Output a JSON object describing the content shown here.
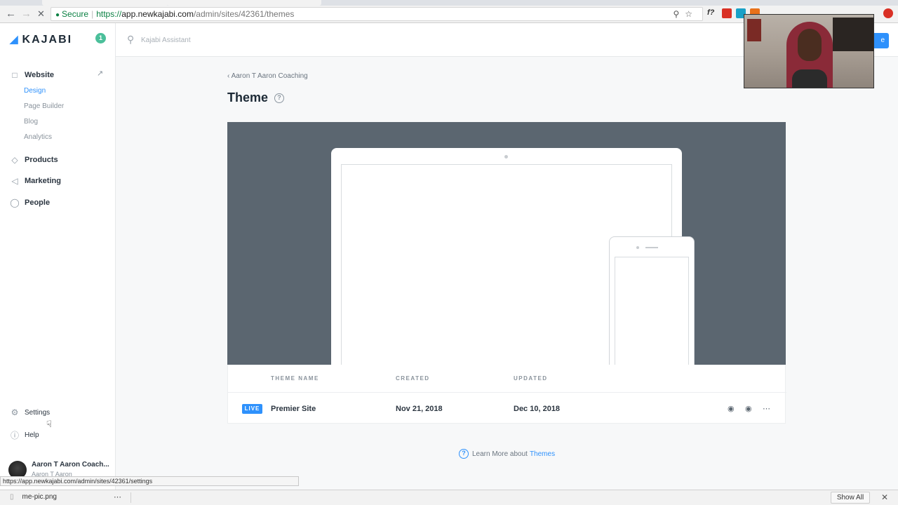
{
  "browser": {
    "secure_label": "Secure",
    "url_scheme": "https://",
    "url_host": "app.newkajabi.com",
    "url_path": "/admin/sites/42361/themes"
  },
  "sidebar": {
    "logo_text": "KAJABI",
    "notification_count": "1",
    "website_label": "Website",
    "website_subitems": [
      {
        "label": "Design",
        "active": true
      },
      {
        "label": "Page Builder",
        "active": false
      },
      {
        "label": "Blog",
        "active": false
      },
      {
        "label": "Analytics",
        "active": false
      }
    ],
    "products_label": "Products",
    "marketing_label": "Marketing",
    "people_label": "People",
    "settings_label": "Settings",
    "help_label": "Help",
    "user_name": "Aaron T Aaron Coach...",
    "user_sub": "Aaron T Aaron"
  },
  "topbar": {
    "search_placeholder": "Kajabi Assistant",
    "button_label": "e"
  },
  "main": {
    "breadcrumb": "Aaron T Aaron Coaching",
    "title": "Theme",
    "table": {
      "headers": [
        "THEME NAME",
        "CREATED",
        "UPDATED"
      ],
      "rows": [
        {
          "badge": "LIVE",
          "name": "Premier Site",
          "created": "Nov 21, 2018",
          "updated": "Dec 10, 2018"
        }
      ]
    },
    "learn_more_prefix": "Learn More about",
    "learn_more_link": "Themes"
  },
  "status_url": "https://app.newkajabi.com/admin/sites/42361/settings",
  "downloads": {
    "file_name": "me-pic.png",
    "show_all": "Show All"
  },
  "colors": {
    "accent": "#2e91fc",
    "preview_bg": "#5b6670",
    "badge_green": "#4bbf9a"
  }
}
